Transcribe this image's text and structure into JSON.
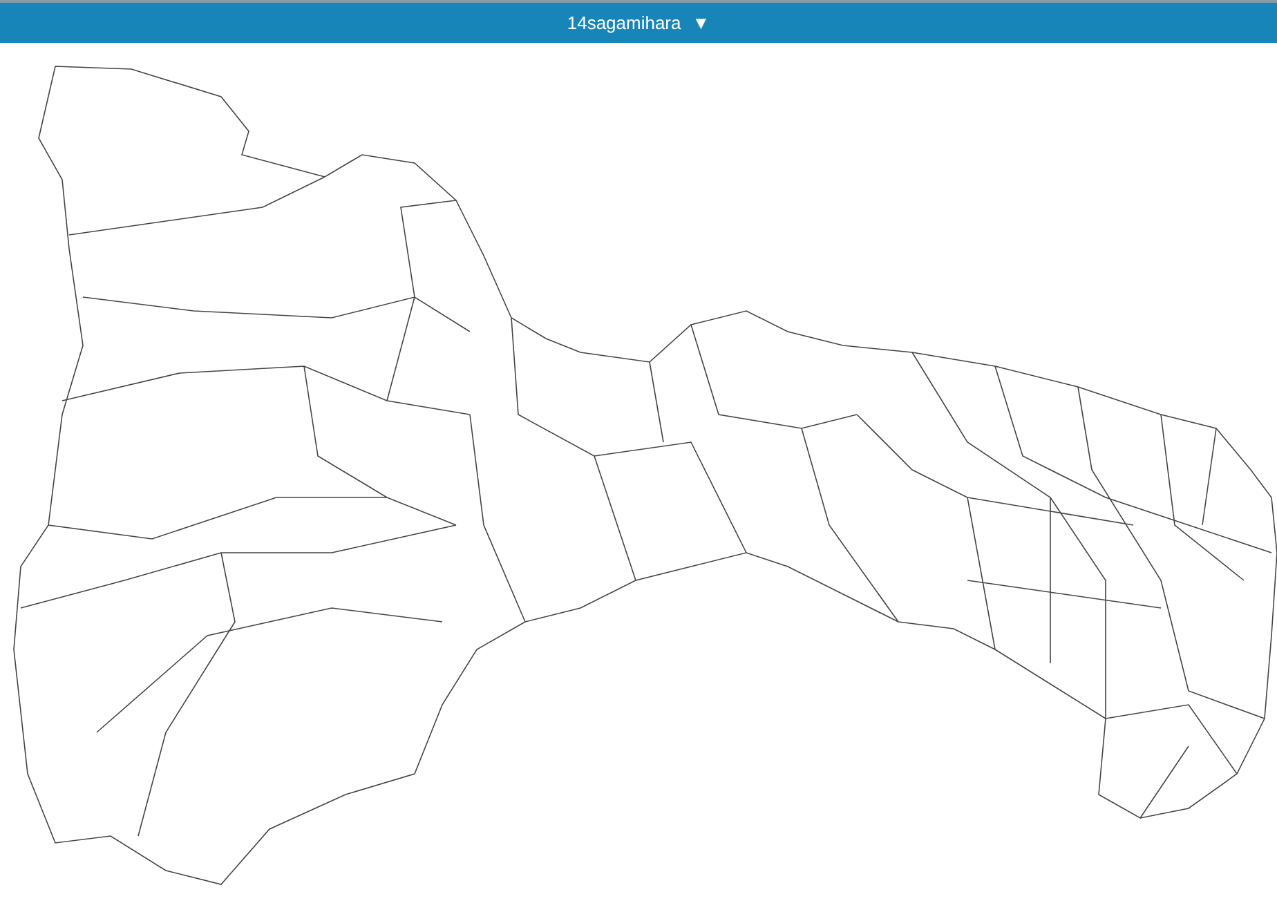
{
  "header": {
    "selector": {
      "label": "14sagamihara",
      "caret": "▼"
    }
  }
}
